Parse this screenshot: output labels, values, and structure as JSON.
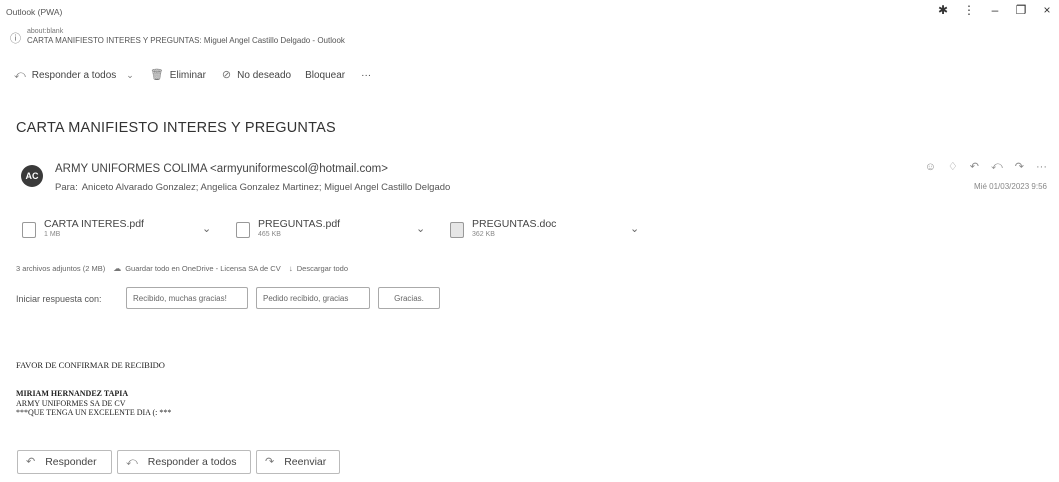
{
  "window": {
    "title": "Outlook (PWA)",
    "url": "about:blank",
    "page_title": "CARTA MANIFIESTO INTERES Y PREGUNTAS: Miguel Angel Castillo Delgado - Outlook"
  },
  "toolbar": {
    "reply_all": "Responder a todos",
    "delete": "Eliminar",
    "junk": "No deseado",
    "block": "Bloquear",
    "more": "···"
  },
  "message": {
    "subject": "CARTA MANIFIESTO INTERES Y PREGUNTAS",
    "avatar_initials": "AC",
    "sender": "ARMY UNIFORMES COLIMA <armyuniformescol@hotmail.com>",
    "to_label": "Para:",
    "recipients": "Aniceto Alvarado Gonzalez;  Angelica Gonzalez Martinez;  Miguel Angel Castillo Delgado",
    "date": "Mié 01/03/2023 9:56"
  },
  "attachments": [
    {
      "name": "CARTA INTERES.pdf",
      "size": "1 MB"
    },
    {
      "name": "PREGUNTAS.pdf",
      "size": "465 KB"
    },
    {
      "name": "PREGUNTAS.doc",
      "size": "362 KB"
    }
  ],
  "attachments_bar": {
    "summary": "3 archivos adjuntos (2 MB)",
    "save_onedrive": "Guardar todo en OneDrive - Licensa SA de CV",
    "download_all": "Descargar todo"
  },
  "quick_reply": {
    "label": "Iniciar respuesta con:",
    "options": [
      "Recibido, muchas gracias!",
      "Pedido recibido, gracias",
      "Gracias."
    ]
  },
  "body": {
    "line1": "FAVOR DE CONFIRMAR DE RECIBIDO",
    "sig1": "MIRIAM HERNANDEZ TAPIA",
    "sig2": "ARMY UNIFORMES SA DE CV",
    "sig3": "***QUE TENGA UN EXCELENTE DIA (: ***"
  },
  "bottom_actions": {
    "reply": "Responder",
    "reply_all": "Responder a todos",
    "forward": "Reenviar"
  }
}
